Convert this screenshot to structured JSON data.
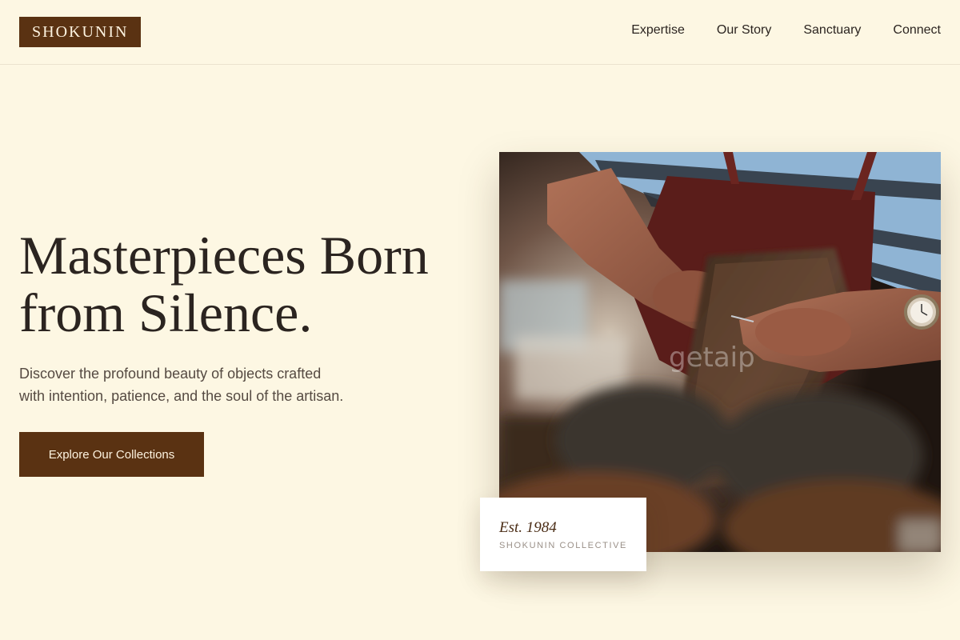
{
  "brand": {
    "logo": "SHOKUNIN"
  },
  "nav": {
    "items": [
      "Expertise",
      "Our Story",
      "Sanctuary",
      "Connect"
    ]
  },
  "hero": {
    "title_line1": "Masterpieces Born",
    "title_line2": "from Silence.",
    "subtitle_line1": "Discover the profound beauty of objects crafted",
    "subtitle_line2": "with intention, patience, and the soul of the artisan.",
    "cta_label": "Explore Our Collections"
  },
  "image": {
    "alt": "Artisan hands carving wood",
    "watermark": "getaip"
  },
  "badge": {
    "established": "Est. 1984",
    "name": "SHOKUNIN COLLECTIVE"
  },
  "colors": {
    "background": "#fdf7e3",
    "accent": "#5a3212",
    "text": "#2b2420"
  }
}
